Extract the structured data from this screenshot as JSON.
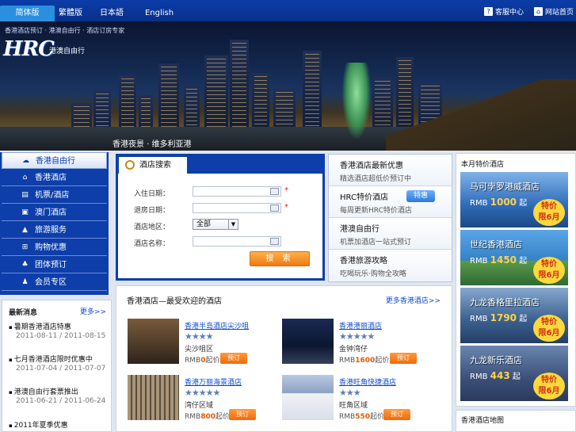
{
  "nav": {
    "langs": [
      "简体版",
      "繁體版",
      "日本語",
      "English"
    ],
    "help": "客服中心",
    "home": "网站首页"
  },
  "banner": {
    "logo": "HRC",
    "logo_sub": "港澳自由行",
    "tagline": "香港酒店预订 · 港澳自由行 · 酒店订房专家",
    "caption": "香港夜景 · 维多利亚港"
  },
  "leftnav": {
    "items": [
      {
        "label": "香港自由行",
        "icon": "home-icon"
      },
      {
        "label": "香港酒店",
        "icon": "building-icon"
      },
      {
        "label": "机票/酒店",
        "icon": "ticket-icon"
      },
      {
        "label": "澳门酒店",
        "icon": "dice-icon"
      },
      {
        "label": "旅游服务",
        "icon": "car-icon"
      },
      {
        "label": "购物优惠",
        "icon": "cart-icon"
      },
      {
        "label": "团体预订",
        "icon": "group-icon"
      },
      {
        "label": "会员专区",
        "icon": "user-icon"
      }
    ]
  },
  "news": {
    "title": "最新消息",
    "more": "更多>>",
    "entries": [
      {
        "title": "暑期香港酒店特惠",
        "date": "2011-08-11 / 2011-08-15"
      },
      {
        "title": "七月香港酒店限时优惠中",
        "date": "2011-07-04 / 2011-07-07"
      },
      {
        "title": "港澳自由行套票推出",
        "date": "2011-06-21 / 2011-06-24"
      },
      {
        "title": "2011年夏季优惠",
        "date": ""
      }
    ]
  },
  "search": {
    "tab": "酒店搜索",
    "labels": [
      "入住日期：",
      "退房日期：",
      "酒店地区：",
      "酒店名称："
    ],
    "checkin": "",
    "checkout": "",
    "area_selected": "全部",
    "hotel_name": "",
    "button": "搜 索",
    "required_mark": "*"
  },
  "promos": [
    {
      "title": "香港酒店最新优惠",
      "sub": "精选酒店超低价预订中"
    },
    {
      "title": "HRC特价酒店",
      "sub": "每周更新HRC特价酒店",
      "badge": "特惠"
    },
    {
      "title": "港澳自由行",
      "sub": "机票加酒店一站式预订"
    },
    {
      "title": "香港旅游攻略",
      "sub": "吃喝玩乐·购物全攻略"
    }
  ],
  "hotels": {
    "title": "香港酒店—最受欢迎的酒店",
    "more": "更多香港酒店>>",
    "cards": [
      {
        "name": "香港半岛酒店尖沙咀",
        "stars": "★★★★",
        "loc": "尖沙咀区",
        "price": "0",
        "unit": "起价",
        "book": "预订"
      },
      {
        "name": "香港港丽酒店",
        "stars": "★★★★★",
        "loc": "金钟湾仔",
        "price": "1600",
        "unit": "起价",
        "book": "预订"
      },
      {
        "name": "香港万丽海景酒店",
        "stars": "★★★★★",
        "loc": "湾仔区域",
        "price": "800",
        "unit": "起价",
        "book": "预订"
      },
      {
        "name": "香港旺角快捷酒店",
        "stars": "★★★",
        "loc": "旺角区域",
        "price": "550",
        "unit": "起价",
        "book": "预订"
      }
    ],
    "currency": "RMB"
  },
  "deals": {
    "title": "本月特价酒店",
    "items": [
      {
        "name": "马可孛罗港威酒店",
        "price": "1000",
        "tag1": "特价",
        "tag2": "限6月"
      },
      {
        "name": "世纪香港酒店",
        "price": "1450",
        "tag1": "特价",
        "tag2": "限6月"
      },
      {
        "name": "九龙香格里拉酒店",
        "price": "1790",
        "tag1": "特价",
        "tag2": "限6月"
      },
      {
        "name": "九龙新乐酒店",
        "price": "443",
        "tag1": "特价",
        "tag2": "限6月"
      }
    ],
    "currency": "RMB",
    "from": "起"
  },
  "map": {
    "title": "香港酒店地图"
  }
}
